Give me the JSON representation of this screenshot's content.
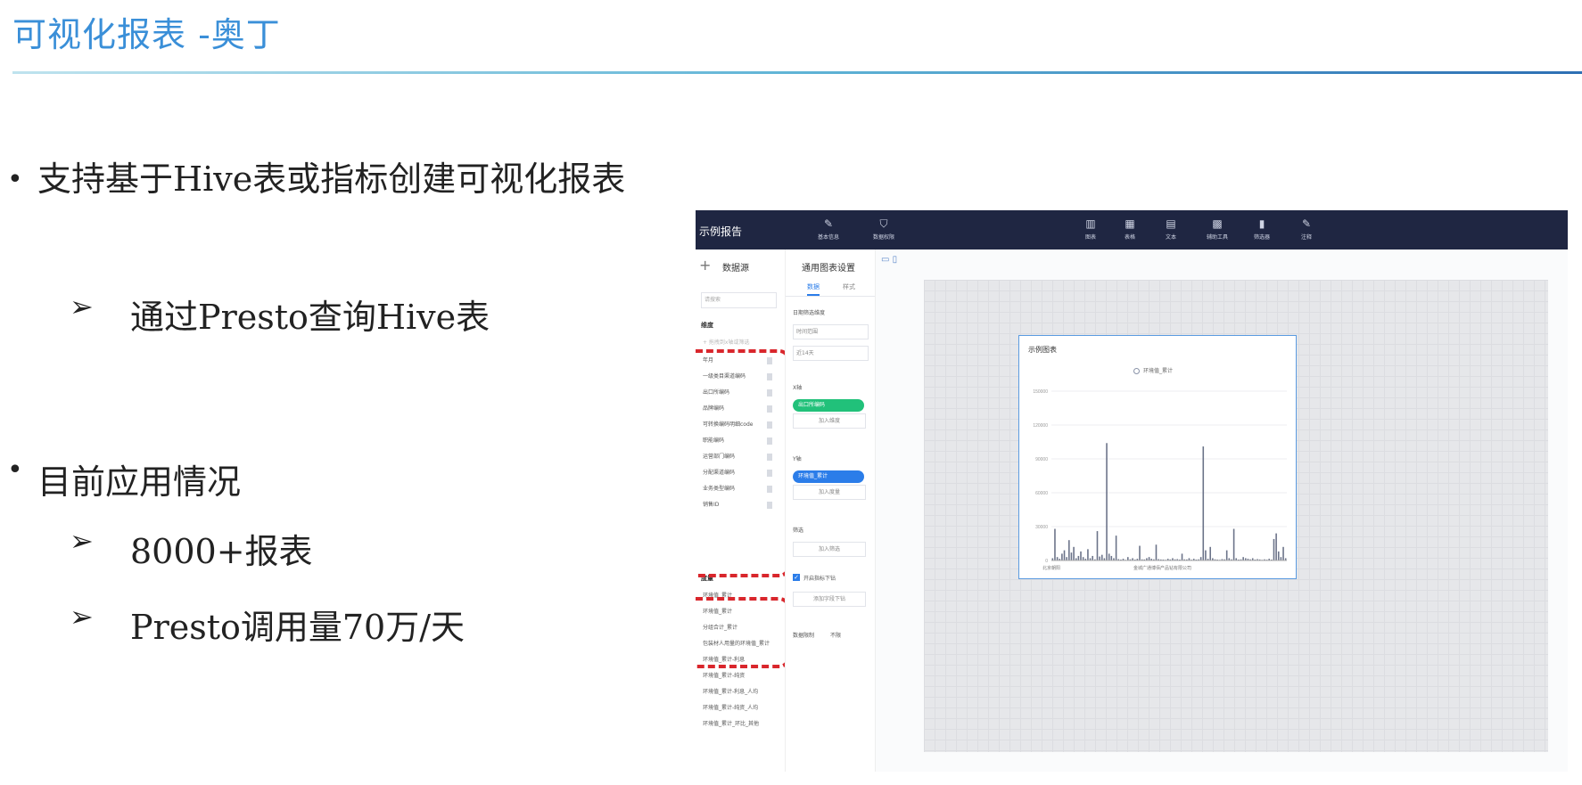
{
  "slide": {
    "title": "可视化报表 -奥丁",
    "bullet1": "支持基于Hive表或指标创建可视化报表",
    "sub1": "通过Presto查询Hive表",
    "bullet2": "目前应用情况",
    "sub2": "8000+报表",
    "sub3": "Presto调用量70万/天",
    "bullet_symbol": "•",
    "arrow_symbol": "➢"
  },
  "app": {
    "brand": "示例报告",
    "toolbar": [
      {
        "icon": "pen-icon",
        "glyph": "✎",
        "label": "基本信息"
      },
      {
        "icon": "shield-icon",
        "glyph": "⛉",
        "label": "数据权限"
      },
      {
        "icon": "chart-icon",
        "glyph": "▥",
        "label": "图表"
      },
      {
        "icon": "table-icon",
        "glyph": "▦",
        "label": "表格"
      },
      {
        "icon": "text-icon",
        "glyph": "▤",
        "label": "文本"
      },
      {
        "icon": "grid-icon",
        "glyph": "▩",
        "label": "辅助工具"
      },
      {
        "icon": "filter-icon",
        "glyph": "▮",
        "label": "筛选器"
      },
      {
        "icon": "note-icon",
        "glyph": "✎",
        "label": "注释"
      }
    ],
    "left_panel": {
      "header": "数据源",
      "search_placeholder": "请搜索",
      "dim_section": "维度",
      "dim_hint": "+ 拖拽到x轴或筛选",
      "dimensions": [
        "年月",
        "一级类目渠道编码",
        "出口所编码",
        "品牌编码",
        "可转换编码明细code",
        "职能编码",
        "运营部门编码",
        "分配渠道编码",
        "业务类型编码",
        "销售ID"
      ],
      "measure_section": "度量",
      "measures": [
        "环境值_累计",
        "环境值_累计",
        "分组合计_累计",
        "包装材人用量的环境值_累计",
        "环境值_累计-利息",
        "环境值_累计-纯资",
        "环境值_累计-利息_人均",
        "环境值_累计-纯资_人均",
        "环境值_累计_环比_其他"
      ]
    },
    "middle_panel": {
      "header": "通用图表设置",
      "tab_data": "数据",
      "tab_style": "样式",
      "date_section": "日期筛选维度",
      "date_field": "时间范围",
      "date_value": "近14天",
      "x_axis": "X轴",
      "x_pill": "出口所编码",
      "x_add": "加入维度",
      "y_axis": "Y轴",
      "y_pill": "环境值_累计",
      "y_add": "加入度量",
      "filter": "筛选",
      "filter_add": "加入筛选",
      "sort_check": "开启指标下钻",
      "sort_more": "添加字段下钻",
      "data_limit_label": "数据限制",
      "data_limit_value": "不限"
    },
    "chart_card": {
      "title": "示例图表",
      "legend": "环境值_累计"
    }
  },
  "chart_data": {
    "type": "bar",
    "title": "",
    "legend": [
      "环境值_累计"
    ],
    "ylim": [
      0,
      150000
    ],
    "yticks": [
      0,
      30000,
      60000,
      90000,
      120000,
      150000
    ],
    "x_tick_labels": [
      "北京朝阳",
      "金城广通博佰产品钻有限公司"
    ],
    "values": [
      2000,
      28000,
      3000,
      1500,
      6000,
      9000,
      3000,
      18000,
      7000,
      12000,
      2000,
      4000,
      8000,
      3000,
      1500,
      10000,
      2000,
      4000,
      1000,
      26000,
      3500,
      5000,
      2000,
      104000,
      6000,
      4000,
      2000,
      22000,
      1200,
      800,
      1500,
      600,
      3000,
      1000,
      2000,
      800,
      1500,
      13000,
      1000,
      900,
      2000,
      3000,
      1500,
      1000,
      14000,
      1200,
      900,
      800,
      600,
      1500,
      900,
      2000,
      1000,
      1200,
      800,
      6000,
      1000,
      900,
      2000,
      700,
      1500,
      800,
      1000,
      3000,
      101000,
      9000,
      1500,
      12000,
      2000,
      1000,
      800,
      600,
      1200,
      1000,
      9000,
      2000,
      1000,
      28000,
      2000,
      800,
      1000,
      3000,
      2000,
      1500,
      1000,
      2000,
      800,
      1200,
      900,
      600,
      1000,
      700,
      1500,
      800,
      19000,
      24000,
      8000,
      3000,
      12000,
      2000
    ]
  }
}
